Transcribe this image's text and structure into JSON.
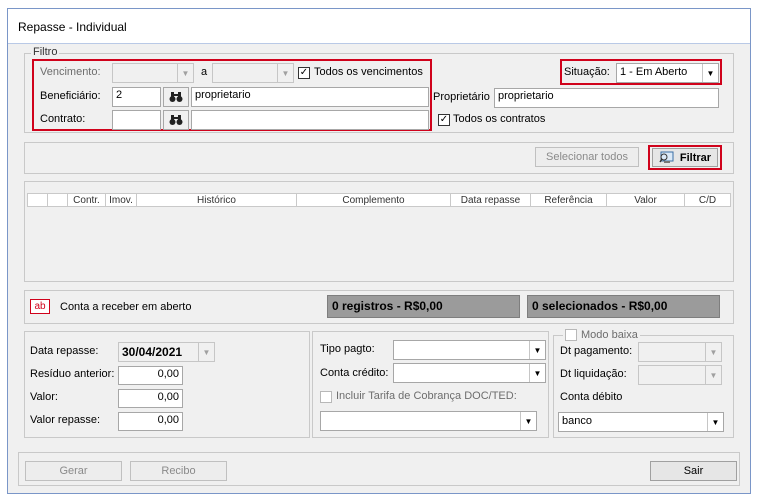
{
  "window": {
    "title": "Repasse - Individual"
  },
  "filtro": {
    "legend": "Filtro",
    "vencimento_label": "Vencimento:",
    "vencimento_a": "a",
    "todos_vencimentos": "Todos os vencimentos",
    "beneficiario_label": "Beneficiário:",
    "beneficiario_code": "2",
    "beneficiario_name": "proprietario",
    "contrato_label": "Contrato:",
    "situacao_label": "Situação:",
    "situacao_value": "1 - Em Aberto",
    "proprietario_label": "Proprietário",
    "proprietario_value": "proprietario",
    "todos_contratos": "Todos os contratos"
  },
  "toolbar": {
    "selecionar_todos": "Selecionar todos",
    "filtrar": "Filtrar"
  },
  "grid": {
    "columns": [
      "",
      "",
      "Contr.",
      "Imov.",
      "Histórico",
      "Complemento",
      "Data repasse",
      "Referência",
      "Valor",
      "C/D"
    ]
  },
  "summary": {
    "legend_icon": "ab",
    "conta_label": "Conta a receber em aberto",
    "registros": "0 registros - R$0,00",
    "selecionados": "0 selecionados - R$0,00"
  },
  "left_panel": {
    "data_repasse_label": "Data repasse:",
    "data_repasse_value": "30/04/2021",
    "residuo_label": "Resíduo anterior:",
    "residuo_value": "0,00",
    "valor_label": "Valor:",
    "valor_value": "0,00",
    "valor_repasse_label": "Valor repasse:",
    "valor_repasse_value": "0,00"
  },
  "mid_panel": {
    "tipo_pagto_label": "Tipo pagto:",
    "conta_credito_label": "Conta crédito:",
    "incluir_tarifa": "Incluir Tarifa de Cobrança DOC/TED:"
  },
  "right_panel": {
    "modo_baixa": "Modo baixa",
    "dt_pagamento_label": "Dt pagamento:",
    "dt_liquidacao_label": "Dt liquidação:",
    "conta_debito_label": "Conta débito",
    "conta_debito_value": "banco"
  },
  "footer": {
    "gerar": "Gerar",
    "recibo": "Recibo",
    "sair": "Sair"
  }
}
